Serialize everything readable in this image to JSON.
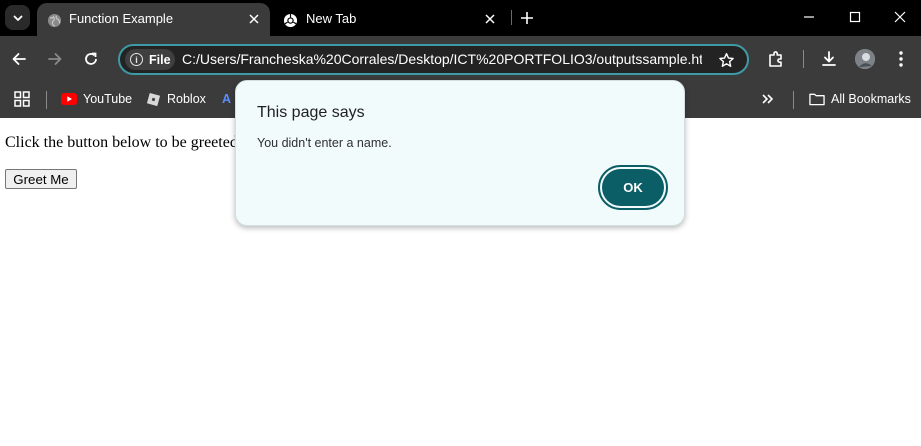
{
  "tabs": [
    {
      "title": "Function Example",
      "favicon": "globe-icon",
      "active": true
    },
    {
      "title": "New Tab",
      "favicon": "chrome-icon",
      "active": false
    }
  ],
  "window_controls": [
    "minimize-icon",
    "maximize-icon",
    "close-icon"
  ],
  "toolbar": {
    "chip_label": "File",
    "url": "C:/Users/Francheska%20Corrales/Desktop/ICT%20PORTFOLIO3/outputssample.ht...",
    "accent_color": "#3e9aa6"
  },
  "bookmarks": {
    "items": [
      {
        "label": "YouTube",
        "icon": "youtube-icon"
      },
      {
        "label": "Roblox",
        "icon": "roblox-icon"
      },
      {
        "label": "A",
        "icon": "bookmark-icon"
      }
    ],
    "all_bookmarks_label": "All Bookmarks"
  },
  "page": {
    "instruction": "Click the button below to be greeted",
    "button_label": "Greet Me"
  },
  "dialog": {
    "title": "This page says",
    "message": "You didn't enter a name.",
    "ok_label": "OK",
    "button_color": "#0b5e66"
  }
}
